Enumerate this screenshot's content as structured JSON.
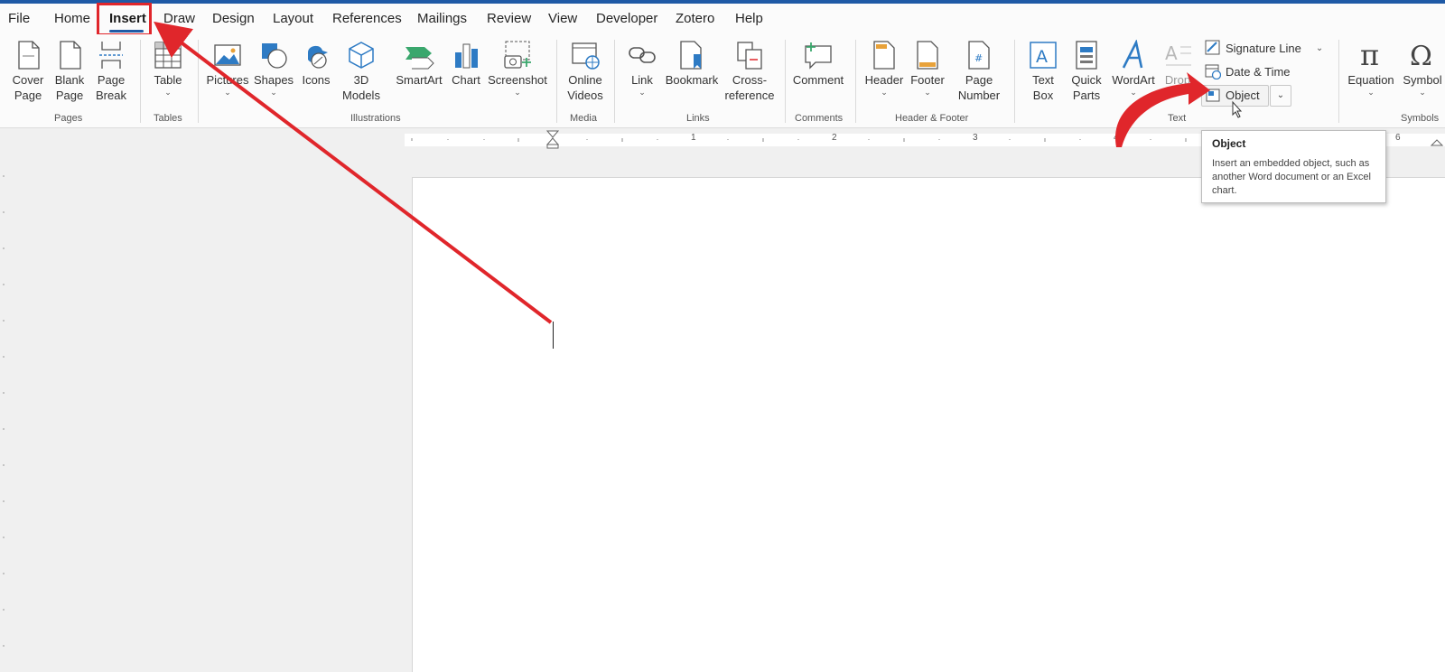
{
  "menu": {
    "tabs": [
      "File",
      "Home",
      "Insert",
      "Draw",
      "Design",
      "Layout",
      "References",
      "Mailings",
      "Review",
      "View",
      "Developer",
      "Zotero",
      "Help"
    ],
    "active": "Insert"
  },
  "ribbon": {
    "pages": {
      "cover": "Cover\nPage",
      "blank": "Blank\nPage",
      "break": "Page\nBreak",
      "group": "Pages"
    },
    "tables": {
      "table": "Table",
      "group": "Tables"
    },
    "illustrations": {
      "pictures": "Pictures",
      "shapes": "Shapes",
      "icons": "Icons",
      "models": "3D\nModels",
      "smartart": "SmartArt",
      "chart": "Chart",
      "screenshot": "Screenshot",
      "group": "Illustrations"
    },
    "media": {
      "videos": "Online\nVideos",
      "group": "Media"
    },
    "links": {
      "link": "Link",
      "bookmark": "Bookmark",
      "crossref": "Cross-\nreference",
      "group": "Links"
    },
    "comments": {
      "comment": "Comment",
      "group": "Comments"
    },
    "header_footer": {
      "header": "Header",
      "footer": "Footer",
      "page_number": "Page\nNumber",
      "group": "Header & Footer"
    },
    "text": {
      "textbox": "Text\nBox",
      "quickparts": "Quick\nParts",
      "wordart": "WordArt",
      "dropcap": "Drop",
      "signature": "Signature Line",
      "datetime": "Date & Time",
      "object": "Object",
      "group": "Text"
    },
    "symbols": {
      "equation": "Equation",
      "symbol": "Symbol",
      "group": "Symbols"
    }
  },
  "ruler": {
    "numbers": [
      "1",
      "2",
      "3",
      "4",
      "6"
    ]
  },
  "tooltip": {
    "title": "Object",
    "body": "Insert an embedded object, such as another Word document or an Excel chart."
  },
  "colors": {
    "accent": "#1f5aa6",
    "annotation": "#e0262b",
    "icon_blue": "#2e7bc4"
  }
}
